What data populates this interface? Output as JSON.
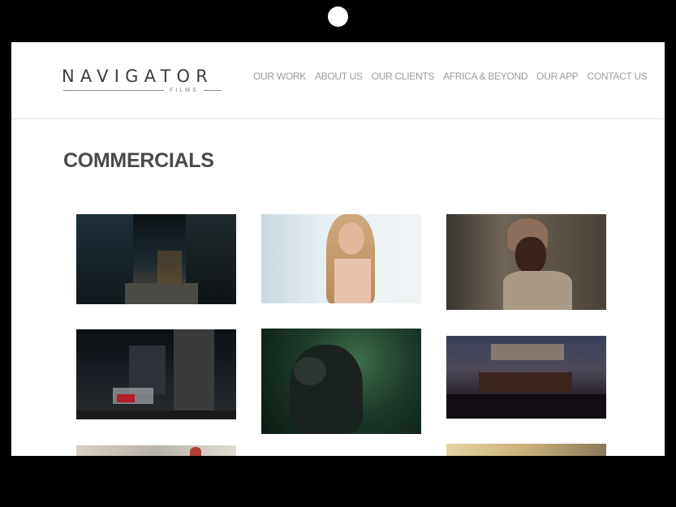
{
  "logo": {
    "main": "NAVIGATOR",
    "sub": "FILMS"
  },
  "nav": [
    "OUR WORK",
    "ABOUT US",
    "OUR CLIENTS",
    "AFRICA & BEYOND",
    "OUR APP",
    "CONTACT US"
  ],
  "page": {
    "title": "COMMERCIALS"
  },
  "thumbnails": [
    {
      "name": "city-street-night"
    },
    {
      "name": "woman-portrait"
    },
    {
      "name": "child-portrait"
    },
    {
      "name": "red-car-city-night"
    },
    {
      "name": "gorilla-jungle"
    },
    {
      "name": "orchestra-hall"
    },
    {
      "name": "partial-thumbnail-1"
    },
    {
      "name": "partial-thumbnail-2"
    }
  ]
}
